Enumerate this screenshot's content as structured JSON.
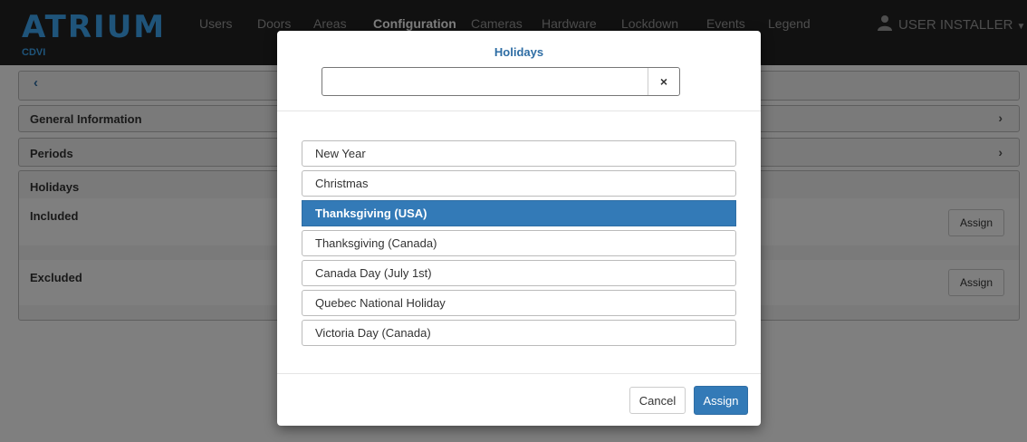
{
  "header": {
    "logo": "ATRIUM",
    "logo_sub": "CDVI",
    "nav": [
      {
        "label": "Users"
      },
      {
        "label": "Doors"
      },
      {
        "label": "Areas"
      },
      {
        "label": "Configuration"
      },
      {
        "label": "Cameras"
      },
      {
        "label": "Hardware"
      },
      {
        "label": "Lockdown"
      },
      {
        "label": "Events"
      },
      {
        "label": "Legend"
      }
    ],
    "active_nav": "Configuration",
    "user_label": "USER INSTALLER"
  },
  "sections": {
    "general_information": "General Information",
    "periods": "Periods",
    "holidays": "Holidays",
    "included": "Included",
    "excluded": "Excluded",
    "assign_label": "Assign"
  },
  "modal": {
    "title": "Holidays",
    "search": {
      "value": "",
      "placeholder": ""
    },
    "clear_label": "×",
    "items": [
      {
        "label": "New Year",
        "selected": false
      },
      {
        "label": "Christmas",
        "selected": false
      },
      {
        "label": "Thanksgiving (USA)",
        "selected": true
      },
      {
        "label": "Thanksgiving (Canada)",
        "selected": false
      },
      {
        "label": "Canada Day (July 1st)",
        "selected": false
      },
      {
        "label": "Quebec National Holiday",
        "selected": false
      },
      {
        "label": "Victoria Day (Canada)",
        "selected": false
      }
    ],
    "cancel_label": "Cancel",
    "assign_label": "Assign"
  },
  "colors": {
    "primary": "#337ab7",
    "topbar": "#222222",
    "logo": "#3fa9f5"
  }
}
